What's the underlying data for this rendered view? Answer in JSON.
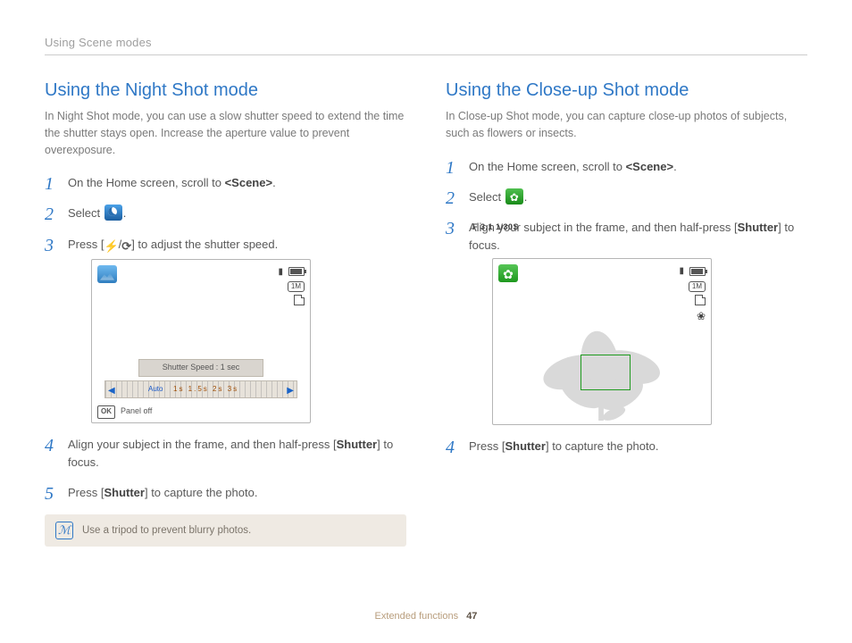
{
  "header": {
    "breadcrumb": "Using Scene modes"
  },
  "left": {
    "title": "Using the Night Shot mode",
    "intro": "In Night Shot mode, you can use a slow shutter speed to extend the time the shutter stays open. Increase the aperture value to prevent overexposure.",
    "steps": {
      "s1_a": "On the Home screen, scroll to ",
      "s1_b": "<Scene>",
      "s1_c": ".",
      "s2": "Select ",
      "s3_a": "Press [",
      "s3_b": "] to adjust the shutter speed.",
      "s4_a": "Align your subject in the frame, and then half-press [",
      "s4_b": "Shutter",
      "s4_c": "] to focus.",
      "s5_a": "Press [",
      "s5_b": "Shutter",
      "s5_c": "] to capture the photo."
    },
    "lcd": {
      "shutter_label": "Shutter Speed : 1 sec",
      "ruler_auto": "Auto",
      "ruler_marks": "1s   1.5s   2s   3s",
      "ok": "OK",
      "panel_off": "Panel off",
      "size_pill": "1M"
    },
    "tip": "Use a tripod to prevent blurry photos."
  },
  "right": {
    "title": "Using the Close-up Shot mode",
    "intro": "In Close-up Shot mode, you can capture close-up photos of subjects, such as flowers or insects.",
    "steps": {
      "s1_a": "On the Home screen, scroll to ",
      "s1_b": "<Scene>",
      "s1_c": ".",
      "s2": "Select ",
      "s3_a": "Align your subject in the frame, and then half-press [",
      "s3_b": "Shutter",
      "s3_c": "] to focus.",
      "s4_a": "Press [",
      "s4_b": "Shutter",
      "s4_c": "] to capture the photo."
    },
    "lcd": {
      "exposure": "F 3.1 1/30S",
      "size_pill": "1M"
    }
  },
  "footer": {
    "section": "Extended functions",
    "page": "47"
  }
}
